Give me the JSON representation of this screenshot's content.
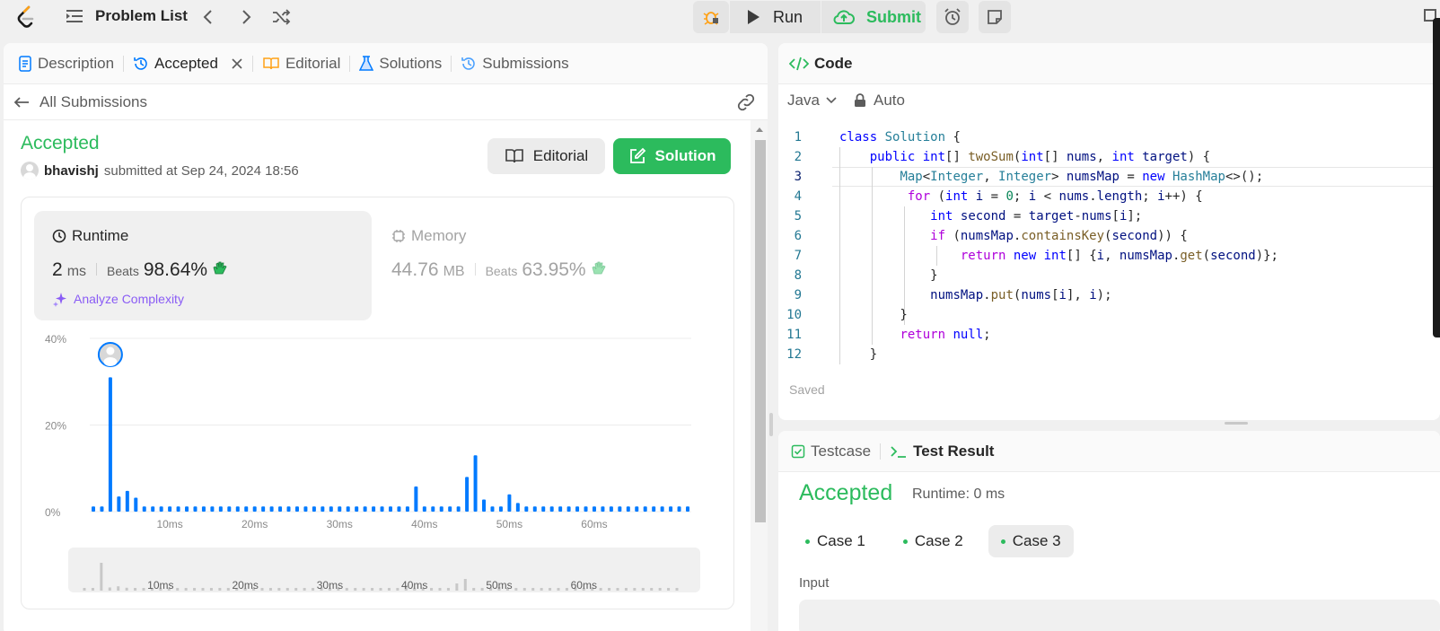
{
  "topbar": {
    "problem_list": "Problem List",
    "run": "Run",
    "submit": "Submit"
  },
  "left_tabs": [
    {
      "label": "Description"
    },
    {
      "label": "Accepted"
    },
    {
      "label": "Editorial"
    },
    {
      "label": "Solutions"
    },
    {
      "label": "Submissions"
    }
  ],
  "submission": {
    "back_label": "All Submissions",
    "status": "Accepted",
    "user": "bhavishj",
    "submitted_text": "submitted at Sep 24, 2024 18:56",
    "editorial_btn": "Editorial",
    "solution_btn": "Solution",
    "runtime_label": "Runtime",
    "runtime_value": "2",
    "runtime_unit": "ms",
    "beats_label": "Beats",
    "runtime_beats": "98.64%",
    "analyze": "Analyze Complexity",
    "memory_label": "Memory",
    "memory_value": "44.76",
    "memory_unit": "MB",
    "memory_beats": "63.95%"
  },
  "chart_data": {
    "type": "bar",
    "y_ticks": [
      "40%",
      "20%",
      "0%"
    ],
    "x_ticks": [
      "10ms",
      "20ms",
      "30ms",
      "40ms",
      "50ms",
      "60ms"
    ],
    "ylim": [
      0,
      40
    ],
    "values": [
      1.2,
      1.2,
      31,
      3.5,
      4.8,
      3.2,
      1.2,
      1.2,
      1.2,
      1.2,
      1.2,
      1.2,
      1.2,
      1.2,
      1.2,
      1.2,
      1.2,
      1.2,
      1.2,
      1.2,
      1.2,
      1.2,
      1.2,
      1.2,
      1.2,
      1.2,
      1.2,
      1.2,
      1.2,
      1.2,
      1.2,
      1.2,
      1.2,
      1.2,
      1.2,
      1.2,
      1.2,
      1.2,
      5.8,
      1.2,
      1.2,
      1.2,
      1.2,
      1.2,
      8,
      13,
      2.8,
      1.2,
      1.2,
      4,
      2,
      1.2,
      1.2,
      1.2,
      1.2,
      1.2,
      1.2,
      1.2,
      1.2,
      1.2,
      1.2,
      1.2,
      1.2,
      1.2,
      1.2,
      1.2,
      1.2,
      1.2,
      1.2,
      1.2,
      1.2
    ],
    "highlight_index": 2,
    "highlight_color": "#007aff"
  },
  "code_panel": {
    "title": "Code",
    "language": "Java",
    "mode": "Auto",
    "saved": "Saved",
    "line_numbers": [
      "1",
      "2",
      "3",
      "4",
      "5",
      "6",
      "7",
      "8",
      "9",
      "10",
      "11",
      "12"
    ]
  },
  "test_panel": {
    "tab_testcase": "Testcase",
    "tab_result": "Test Result",
    "status": "Accepted",
    "runtime": "Runtime: 0 ms",
    "cases": [
      "Case 1",
      "Case 2",
      "Case 3"
    ],
    "input_label": "Input"
  },
  "colors": {
    "accent_green": "#2cbb5d",
    "blue": "#007aff"
  }
}
